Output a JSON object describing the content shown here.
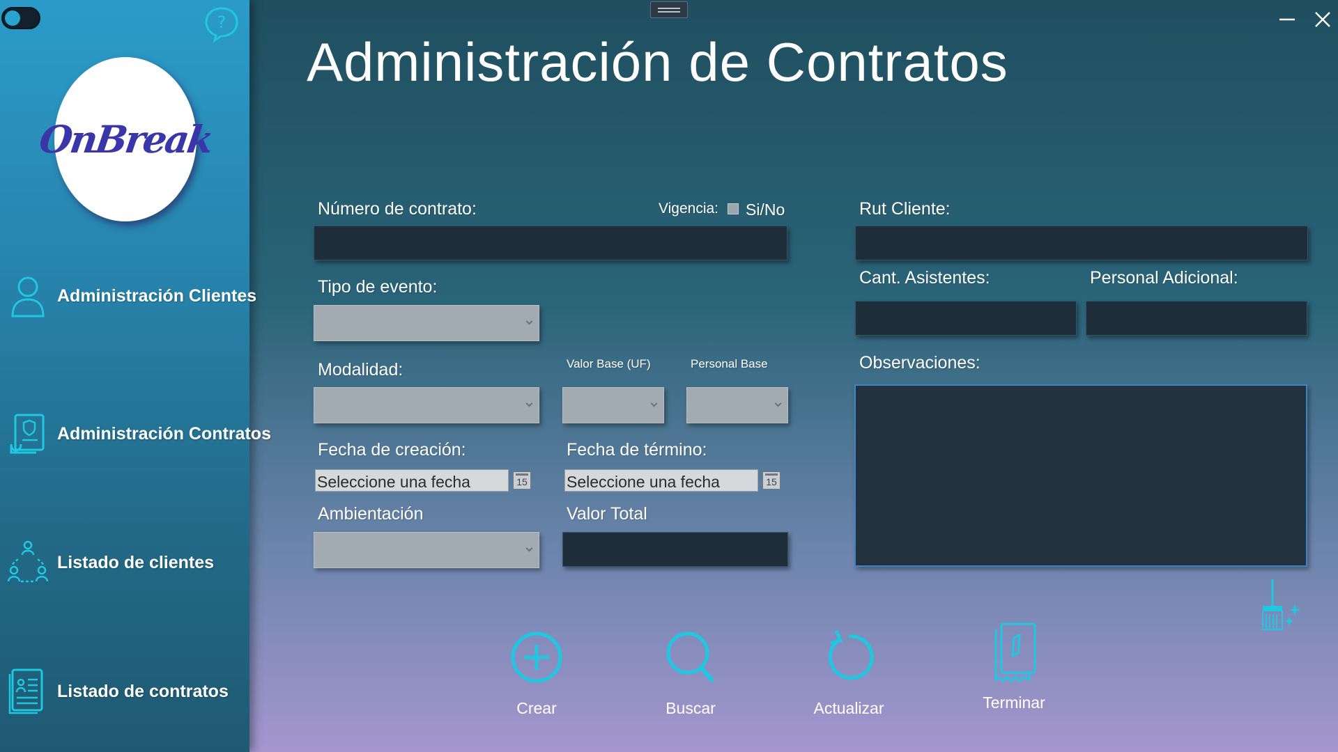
{
  "window": {
    "minimize_icon": "minimize-icon",
    "close_icon": "close-icon"
  },
  "sidebar": {
    "logo_text": "OnBreak",
    "items": [
      {
        "label": "Administración Clientes",
        "icon": "user-icon"
      },
      {
        "label": "Administración Contratos",
        "icon": "contract-scroll-icon"
      },
      {
        "label": "Listado de clientes",
        "icon": "clients-group-icon"
      },
      {
        "label": "Listado de contratos",
        "icon": "contract-list-icon"
      }
    ]
  },
  "main": {
    "title": "Administración de Contratos",
    "labels": {
      "numero_contrato": "Número de contrato:",
      "vigencia": "Vigencia:",
      "si_no": "Si/No",
      "rut_cliente": "Rut Cliente:",
      "tipo_evento": "Tipo de evento:",
      "cant_asistentes": "Cant. Asistentes:",
      "personal_adicional": "Personal Adicional:",
      "modalidad": "Modalidad:",
      "valor_base": "Valor Base (UF)",
      "personal_base": "Personal Base",
      "observaciones": "Observaciones:",
      "fecha_creacion": "Fecha de creación:",
      "fecha_termino": "Fecha de término:",
      "ambientacion": "Ambientación",
      "valor_total": "Valor Total"
    },
    "fields": {
      "numero_contrato": "",
      "rut_cliente": "",
      "cant_asistentes": "",
      "personal_adicional": "",
      "valor_total": "",
      "observaciones": ""
    },
    "date_placeholder": "Seleccione una fecha",
    "calendar_day": "15",
    "vigencia_checked": false
  },
  "actions": [
    {
      "label": "Crear",
      "icon": "add-circle-icon"
    },
    {
      "label": "Buscar",
      "icon": "search-icon"
    },
    {
      "label": "Actualizar",
      "icon": "refresh-icon"
    },
    {
      "label": "Terminar",
      "icon": "terminate-document-icon"
    }
  ],
  "colors": {
    "accent": "#1fc8e0",
    "sidebar_top": "#2b9bc9",
    "field_bg": "#1d2d3a"
  }
}
